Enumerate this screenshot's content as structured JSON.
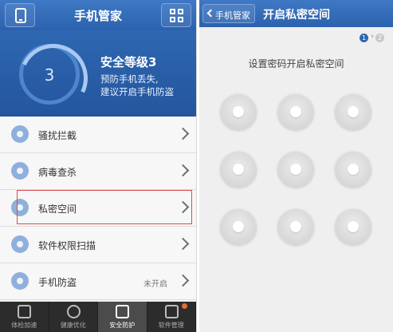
{
  "left": {
    "header": {
      "title": "手机管家"
    },
    "security": {
      "score": "3",
      "title": "安全等级3",
      "line1": "预防手机丢失,",
      "line2": "建议开启手机防盗"
    },
    "menu": [
      {
        "label": "骚扰拦截",
        "status": "",
        "icon": "phone-block-icon"
      },
      {
        "label": "病毒查杀",
        "status": "",
        "icon": "shield-icon"
      },
      {
        "label": "私密空间",
        "status": "",
        "icon": "private-space-icon"
      },
      {
        "label": "软件权限扫描",
        "status": "",
        "icon": "permission-scan-icon"
      },
      {
        "label": "手机防盗",
        "status": "未开启",
        "icon": "lock-icon"
      }
    ],
    "tabs": [
      {
        "label": "体检加速",
        "active": false
      },
      {
        "label": "健康优化",
        "active": false
      },
      {
        "label": "安全防护",
        "active": true
      },
      {
        "label": "软件管理",
        "active": false
      }
    ]
  },
  "right": {
    "header": {
      "back_label": "手机管家",
      "title": "开启私密空间"
    },
    "steps": {
      "current": "1",
      "separator": "›",
      "next": "2"
    },
    "prompt": "设置密码开启私密空间"
  },
  "colors": {
    "header_blue": "#2c62ad",
    "highlight_red": "#e04848",
    "tabbar": "#2c2c2c"
  }
}
